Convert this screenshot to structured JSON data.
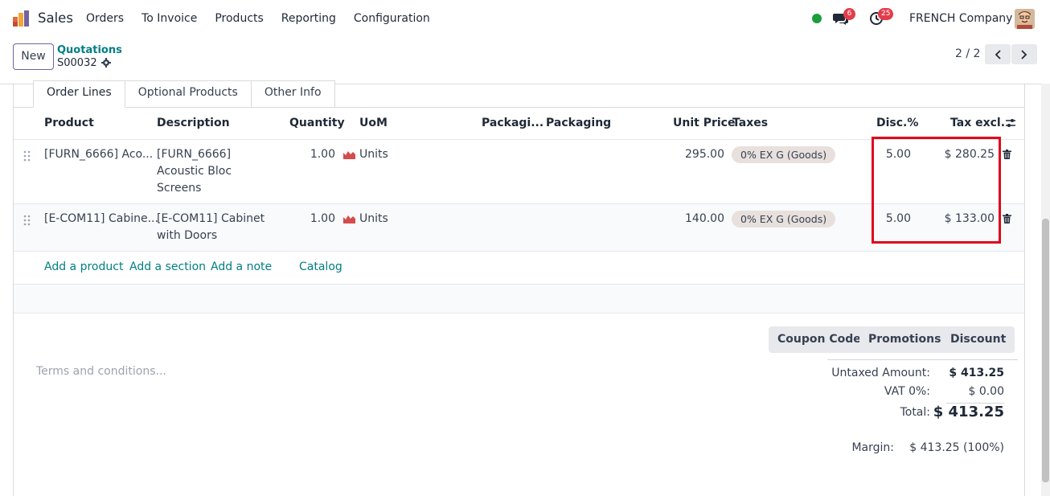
{
  "navbar": {
    "app_name": "Sales",
    "menu": [
      "Orders",
      "To Invoice",
      "Products",
      "Reporting",
      "Configuration"
    ],
    "chat_count": "6",
    "activity_count": "25",
    "company": "FRENCH Company",
    "status_color": "#1a9e3b"
  },
  "control_panel": {
    "new_label": "New",
    "breadcrumb_parent": "Quotations",
    "breadcrumb_current": "S00032",
    "pager": "2 / 2"
  },
  "tabs": [
    "Order Lines",
    "Optional Products",
    "Other Info"
  ],
  "table": {
    "headers": {
      "product": "Product",
      "description": "Description",
      "quantity": "Quantity",
      "uom": "UoM",
      "packaging_qty": "Packagi...",
      "packaging": "Packaging",
      "unit_price": "Unit Price",
      "taxes": "Taxes",
      "disc": "Disc.%",
      "tax_excl": "Tax excl."
    },
    "rows": [
      {
        "product": "[FURN_6666] Aco...",
        "description_lines": [
          "[FURN_6666]",
          "Acoustic Bloc",
          "Screens"
        ],
        "quantity": "1.00",
        "uom": "Units",
        "unit_price": "295.00",
        "tax": "0% EX G (Goods)",
        "disc": "5.00",
        "tax_excl": "$ 280.25"
      },
      {
        "product": "[E-COM11] Cabine...",
        "description_lines": [
          "[E-COM11] Cabinet",
          "with Doors"
        ],
        "quantity": "1.00",
        "uom": "Units",
        "unit_price": "140.00",
        "tax": "0% EX G (Goods)",
        "disc": "5.00",
        "tax_excl": "$ 133.00"
      }
    ],
    "add_links": [
      "Add a product",
      "Add a section",
      "Add a note",
      "Catalog"
    ]
  },
  "buttons": [
    "Coupon Code",
    "Promotions",
    "Discount"
  ],
  "terms_placeholder": "Terms and conditions...",
  "totals": {
    "untaxed_label": "Untaxed Amount:",
    "untaxed_value": "$ 413.25",
    "vat_label": "VAT 0%:",
    "vat_value": "$ 0.00",
    "total_label": "Total:",
    "total_value": "$ 413.25",
    "margin_label": "Margin:",
    "margin_value": "$ 413.25 (100%)"
  },
  "colors": {
    "accent": "#017e84",
    "highlight": "#e0061b",
    "badge": "#e13d4b"
  }
}
